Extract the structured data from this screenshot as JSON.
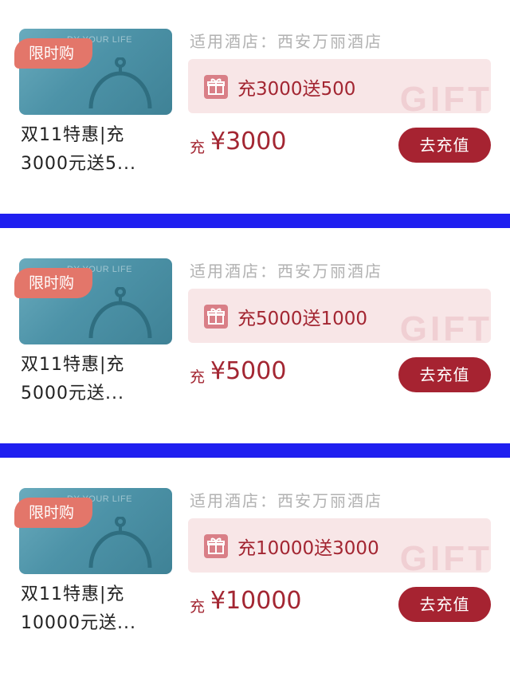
{
  "offers": [
    {
      "tag": "限时购",
      "watermark": "DY YOUR LIFE",
      "title": "双11特惠|充\n3000元送5...",
      "hotel": "适用酒店：西安万丽酒店",
      "gift": "充3000送500",
      "gift_watermark": "GIFT",
      "price_prefix": "充",
      "price": "¥3000",
      "cta": "去充值"
    },
    {
      "tag": "限时购",
      "watermark": "DY YOUR LIFE",
      "title": "双11特惠|充\n5000元送...",
      "hotel": "适用酒店：西安万丽酒店",
      "gift": "充5000送1000",
      "gift_watermark": "GIFT",
      "price_prefix": "充",
      "price": "¥5000",
      "cta": "去充值"
    },
    {
      "tag": "限时购",
      "watermark": "DY YOUR LIFE",
      "title": "双11特惠|充\n10000元送...",
      "hotel": "适用酒店：西安万丽酒店",
      "gift": "充10000送3000",
      "gift_watermark": "GIFT",
      "price_prefix": "充",
      "price": "¥10000",
      "cta": "去充值"
    }
  ],
  "colors": {
    "accent": "#a62331",
    "tag": "#e3766a",
    "gift_bg": "#f8e6e7",
    "separator": "#1f1ff0",
    "thumb": "#4d93a8"
  },
  "icons": {
    "thumb_icon": "cloche-icon",
    "gift_icon": "gift-icon"
  }
}
